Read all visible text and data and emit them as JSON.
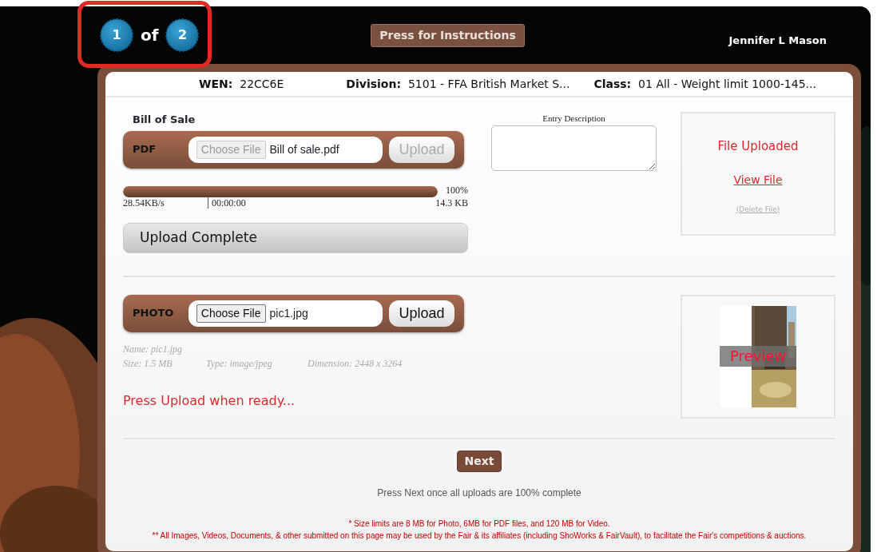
{
  "steps": {
    "items": [
      {
        "label": "1"
      },
      {
        "label": "2"
      }
    ],
    "separator": "of"
  },
  "instructions_button": "Press for Instructions",
  "user_name": "Jennifer L Mason",
  "header_fields": [
    {
      "label": "WEN:",
      "value": "22CC6E"
    },
    {
      "label": "Division:",
      "value": "5101 - FFA British Market S..."
    },
    {
      "label": "Class:",
      "value": "01 All - Weight limit 1000-145..."
    }
  ],
  "uploads": [
    {
      "kind": "pdf",
      "title": "Bill of Sale",
      "type_label": "PDF",
      "choose_button": "Choose File",
      "file_name": "Bill of sale.pdf",
      "upload_button": "Upload",
      "disabled": true,
      "progress": {
        "level": 1,
        "percent": "100%",
        "speed": "28.54KB/s",
        "time": "00:00:00",
        "size": "14.3 KB"
      },
      "status_button": "Upload Complete",
      "description_label": "Entry Description",
      "result": {
        "status": "File Uploaded",
        "view_link": "View File",
        "delete_link": "(Delete File)"
      }
    },
    {
      "type_label": "PHOTO",
      "choose_button": "Choose File",
      "file_name": "pic1.jpg",
      "upload_button": "Upload",
      "disabled": false,
      "info": {
        "name": "Name: pic1.jpg",
        "size": "Size: 1.5 MB",
        "type": "Type: image/jpeg",
        "dimension": "Dimension: 2448 x 3264"
      },
      "message": "Press Upload when ready...",
      "preview_label": "Preview"
    }
  ],
  "next_button": "Next",
  "next_hint": "Press Next once all uploads are 100% complete",
  "notes": [
    "* Size limits are 8 MB for Photo, 6MB for PDF files, and 120 MB for Video.",
    "** All Images, Videos, Documents, & other submitted on this page may be used by the Fair & its affiliates (including ShoWorks & FairVault), to facilitate the Fair's competitions & auctions."
  ]
}
